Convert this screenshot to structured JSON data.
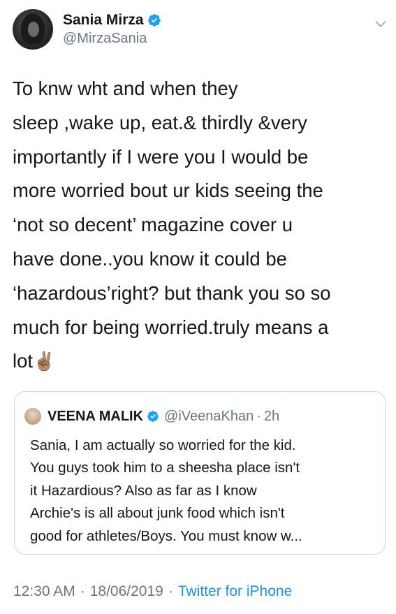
{
  "colors": {
    "verified_blue": "#1da1f2",
    "link_blue": "#1b95e0",
    "secondary_text": "#657786",
    "border": "#ccd6dd"
  },
  "tweet": {
    "author": {
      "display_name": "Sania Mirza",
      "handle": "@MirzaSania",
      "verified_icon": "verified-badge-icon"
    },
    "menu_icon": "chevron-down-icon",
    "text": "To knw wht and when they\nsleep ,wake up, eat.& thirdly &very\nimportantly if I were you I would be\nmore worried bout ur kids seeing the\n‘not so decent’ magazine cover u\nhave done..you know it could be\n‘hazardous’right? but thank you so so\nmuch for being worried.truly means a\nlot",
    "emoji": "✌🏽",
    "quoted_tweet": {
      "display_name": "VEENA MALIK",
      "handle": "@iVeenaKhan",
      "separator": "·",
      "time": "2h",
      "text": "Sania, I am actually so worried for the kid.\nYou guys took him to a sheesha place isn't\nit Hazardious? Also as far as I know\nArchie's is all about junk food which isn't\ngood for athletes/Boys. You must know w..."
    },
    "footer": {
      "time": "12:30 AM",
      "separator": "·",
      "date": "18/06/2019",
      "source": "Twitter for iPhone"
    }
  }
}
